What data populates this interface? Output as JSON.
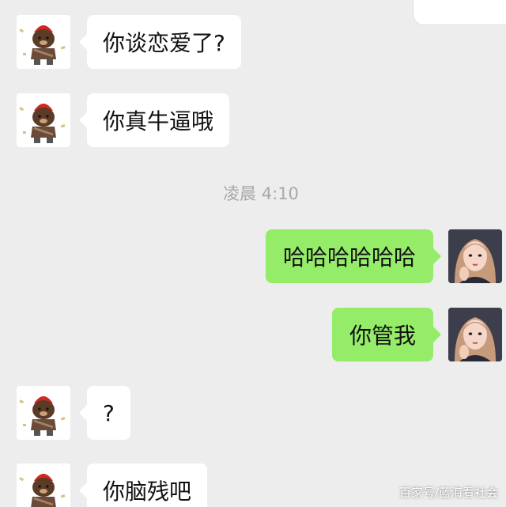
{
  "app": {
    "background": "#ededed",
    "incoming_bubble_color": "#ffffff",
    "outgoing_bubble_color": "#95ec69"
  },
  "messages": [
    {
      "direction": "incoming",
      "avatar": "bear-sticker-avatar",
      "text": "你谈恋爱了?"
    },
    {
      "direction": "incoming",
      "avatar": "bear-sticker-avatar",
      "text": "你真牛逼哦"
    },
    {
      "type": "timestamp",
      "text": "凌晨 4:10"
    },
    {
      "direction": "outgoing",
      "avatar": "girl-portrait-avatar",
      "text": "哈哈哈哈哈哈"
    },
    {
      "direction": "outgoing",
      "avatar": "girl-portrait-avatar",
      "text": "你管我"
    },
    {
      "direction": "incoming",
      "avatar": "bear-sticker-avatar",
      "text": "?"
    },
    {
      "direction": "incoming",
      "avatar": "bear-sticker-avatar",
      "text": "你脑残吧"
    }
  ],
  "watermark": "百家号/蓝海看社会"
}
